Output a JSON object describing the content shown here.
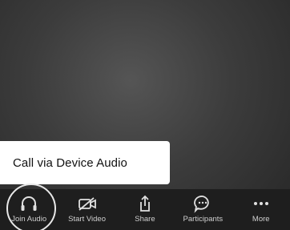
{
  "popup": {
    "label": "Call via Device Audio"
  },
  "toolbar": {
    "items": [
      {
        "label": "Join Audio",
        "icon": "headphones-icon"
      },
      {
        "label": "Start Video",
        "icon": "video-camera-icon"
      },
      {
        "label": "Share",
        "icon": "share-icon"
      },
      {
        "label": "Participants",
        "icon": "chat-bubble-icon"
      },
      {
        "label": "More",
        "icon": "more-dots-icon"
      }
    ]
  },
  "colors": {
    "toolbar_bg": "#1e1e1e",
    "popup_bg": "#ffffff",
    "icon": "#e0e0e0"
  }
}
